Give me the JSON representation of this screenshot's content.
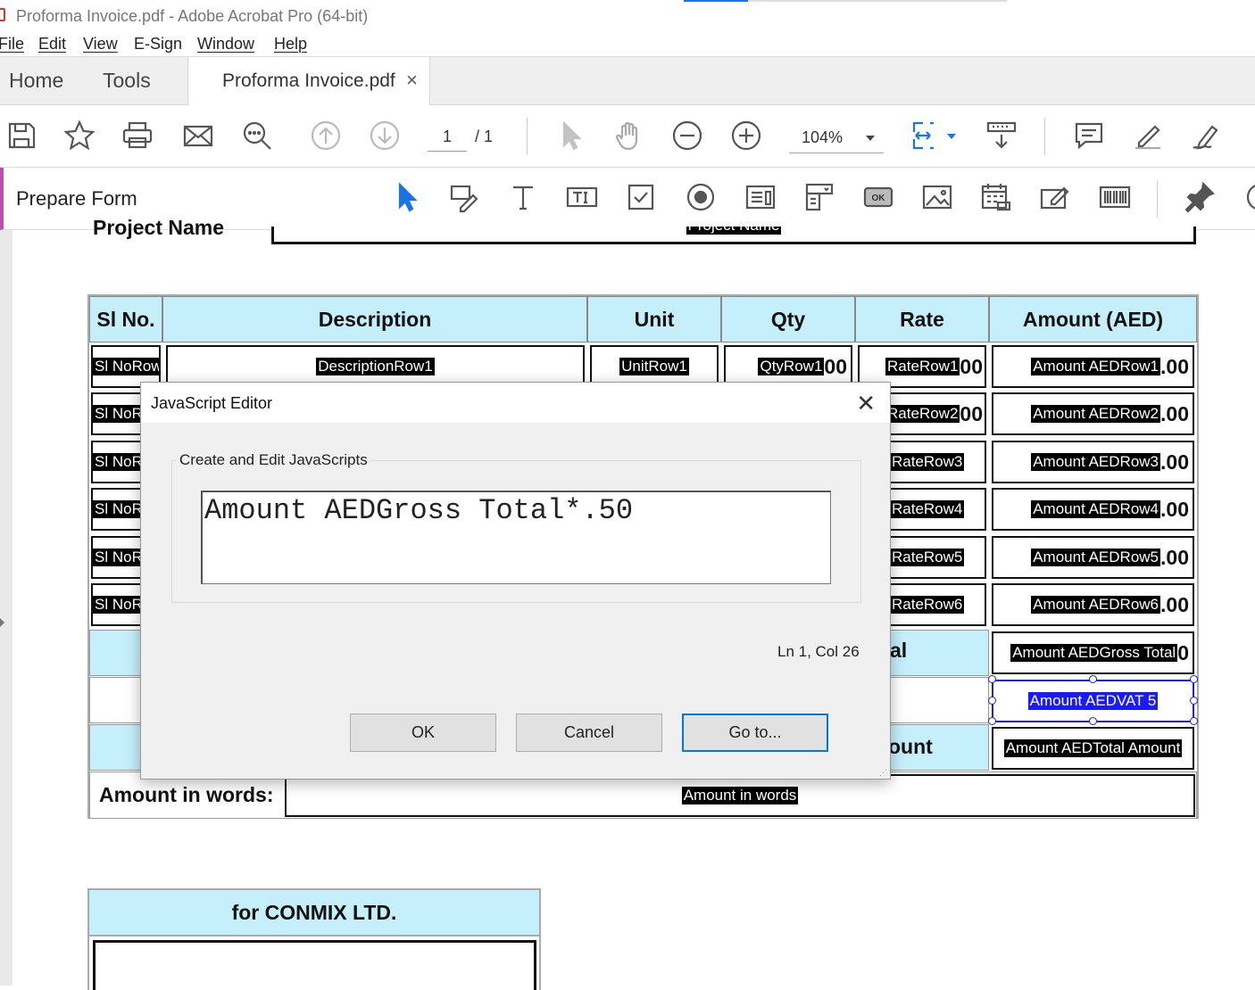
{
  "window": {
    "title": "Proforma Invoice.pdf - Adobe Acrobat Pro (64-bit)"
  },
  "menu": [
    "File",
    "Edit",
    "View",
    "E-Sign",
    "Window",
    "Help"
  ],
  "tabs": {
    "home": "Home",
    "tools": "Tools",
    "document": "Proforma Invoice.pdf",
    "close": "×"
  },
  "toolbar": {
    "page_current": "1",
    "page_total": "/ 1",
    "zoom": "104%"
  },
  "form_toolbar": {
    "title": "Prepare Form"
  },
  "document": {
    "project_label": "Project Name",
    "project_field": "Project Name",
    "columns": [
      "Sl No.",
      "Description",
      "Unit",
      "Qty",
      "Rate",
      "Amount (AED)"
    ],
    "rows": [
      {
        "sl": "Sl NoRow",
        "desc": "DescriptionRow1",
        "unit": "UnitRow1",
        "qty": "QtyRow1",
        "qty_tail": "00",
        "rate": "RateRow1",
        "rate_tail": "00",
        "amount": "Amount AEDRow1",
        "amount_tail": ".00"
      },
      {
        "sl": "Sl NoR",
        "rate": "RateRow2",
        "rate_tail": "00",
        "amount": "Amount AEDRow2",
        "amount_tail": ".00"
      },
      {
        "sl": "Sl NoR",
        "rate": "RateRow3",
        "amount": "Amount AEDRow3",
        "amount_tail": ".00"
      },
      {
        "sl": "Sl NoR",
        "rate": "RateRow4",
        "amount": "Amount AEDRow4",
        "amount_tail": ".00"
      },
      {
        "sl": "Sl NoR",
        "rate": "RateRow5",
        "amount": "Amount AEDRow5",
        "amount_tail": ".00"
      },
      {
        "sl": "Sl NoRov",
        "rate": "RateRow6",
        "amount": "Amount AEDRow6",
        "amount_tail": ".00"
      }
    ],
    "gross_label_tail": "al",
    "gross_field": "Amount AEDGross Total",
    "gross_tail": "0",
    "vat_field": "Amount AEDVAT 5",
    "total_label_tail": "ount",
    "total_field": "Amount AEDTotal Amount",
    "words_label": "Amount in words:",
    "words_field": "Amount in words",
    "signature_header": "for CONMIX LTD."
  },
  "dialog": {
    "title": "JavaScript Editor",
    "close": "✕",
    "group_label": "Create and Edit JavaScripts",
    "script": "Amount AEDGross Total*.50",
    "status": "Ln 1, Col 26",
    "ok": "OK",
    "cancel": "Cancel",
    "goto": "Go to..."
  },
  "colors": {
    "header_fill": "#c6effc",
    "accent_blue": "#1a73e8",
    "form_accent": "#b84fb3",
    "selected_field": "#1a1aff"
  }
}
